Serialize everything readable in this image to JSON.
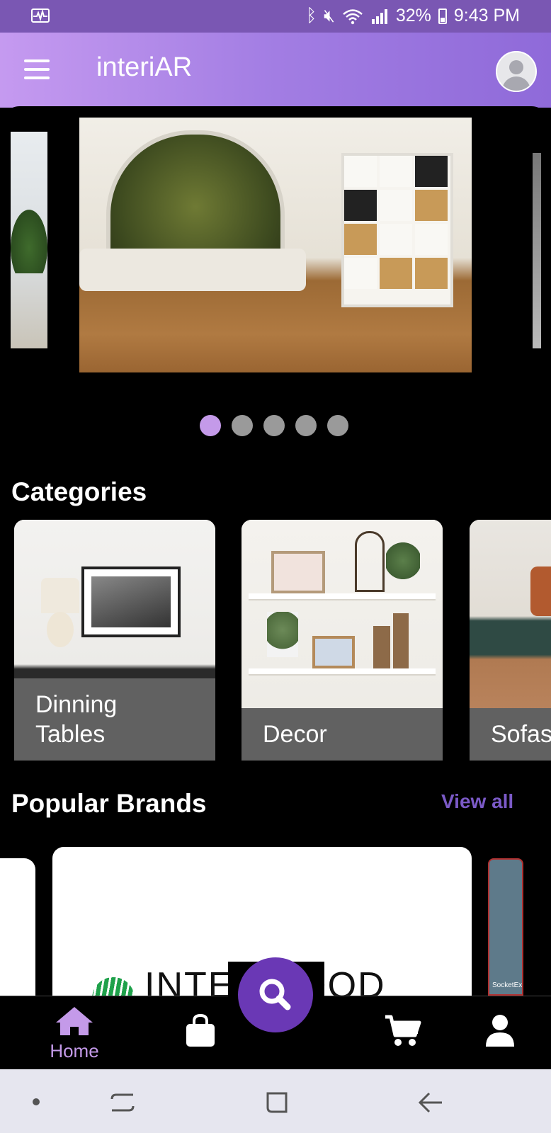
{
  "status_bar": {
    "battery": "32%",
    "time": "9:43 PM"
  },
  "app_bar": {
    "title": "interiAR"
  },
  "carousel": {
    "slide_count": 5,
    "active_index": 0
  },
  "categories": {
    "title": "Categories",
    "items": [
      {
        "label": "Dinning\nTables"
      },
      {
        "label": "Decor"
      },
      {
        "label": "Sofas"
      }
    ]
  },
  "popular_brands": {
    "title": "Popular Brands",
    "view_all": "View all",
    "featured_brand": "INTERWOOD",
    "side_brand_caption": "SocketEx"
  },
  "bottom_nav": {
    "home_label": "Home",
    "accent_color": "#c49ae9",
    "fab_color": "#6a38b5"
  }
}
